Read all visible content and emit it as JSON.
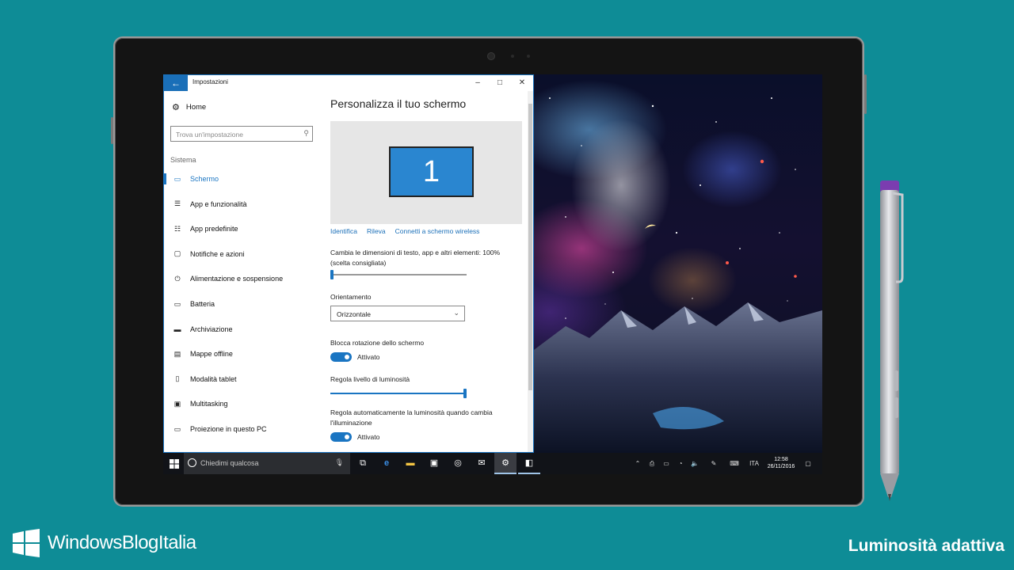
{
  "window": {
    "title": "Impostazioni",
    "back_icon": "←",
    "minimize_icon": "–",
    "maximize_icon": "□",
    "close_icon": "✕"
  },
  "nav": {
    "home_label": "Home",
    "search_placeholder": "Trova un'impostazione",
    "section_label": "Sistema",
    "items": [
      {
        "label": "Schermo",
        "icon": "monitor-icon",
        "glyph": "▭",
        "active": true
      },
      {
        "label": "App e funzionalità",
        "icon": "apps-list-icon",
        "glyph": "☰"
      },
      {
        "label": "App predefinite",
        "icon": "default-apps-icon",
        "glyph": "☷"
      },
      {
        "label": "Notifiche e azioni",
        "icon": "notifications-icon",
        "glyph": "▢"
      },
      {
        "label": "Alimentazione e sospensione",
        "icon": "power-icon",
        "glyph": "⏻"
      },
      {
        "label": "Batteria",
        "icon": "battery-icon",
        "glyph": "▭"
      },
      {
        "label": "Archiviazione",
        "icon": "storage-icon",
        "glyph": "▬"
      },
      {
        "label": "Mappe offline",
        "icon": "map-icon",
        "glyph": "▤"
      },
      {
        "label": "Modalità tablet",
        "icon": "tablet-mode-icon",
        "glyph": "▯"
      },
      {
        "label": "Multitasking",
        "icon": "multitasking-icon",
        "glyph": "▣"
      },
      {
        "label": "Proiezione in questo PC",
        "icon": "projection-icon",
        "glyph": "▭"
      }
    ]
  },
  "content": {
    "title": "Personalizza il tuo schermo",
    "monitor_number": "1",
    "links": [
      "Identifica",
      "Rileva",
      "Connetti a schermo wireless"
    ],
    "scale_label": "Cambia le dimensioni di testo, app e altri elementi: 100%",
    "scale_label_2": "(scelta consigliata)",
    "scale_value": 0,
    "orientation_label": "Orientamento",
    "orientation_value": "Orizzontale",
    "rotation_lock_label": "Blocca rotazione dello schermo",
    "rotation_lock_state": "Attivato",
    "brightness_label": "Regola livello di luminosità",
    "brightness_value": 1.0,
    "auto_brightness_label": "Regola automaticamente la luminosità quando cambia",
    "auto_brightness_label_2": "l'illuminazione",
    "auto_brightness_state": "Attivato"
  },
  "taskbar": {
    "search_placeholder": "Chiedimi qualcosa",
    "language": "ITA",
    "time": "12:58",
    "date": "26/11/2016"
  },
  "branding": {
    "site_name": "WindowsBlogItalia",
    "caption": "Luminosità adattiva"
  },
  "colors": {
    "background": "#0e8c96",
    "accent": "#1a75c2"
  }
}
